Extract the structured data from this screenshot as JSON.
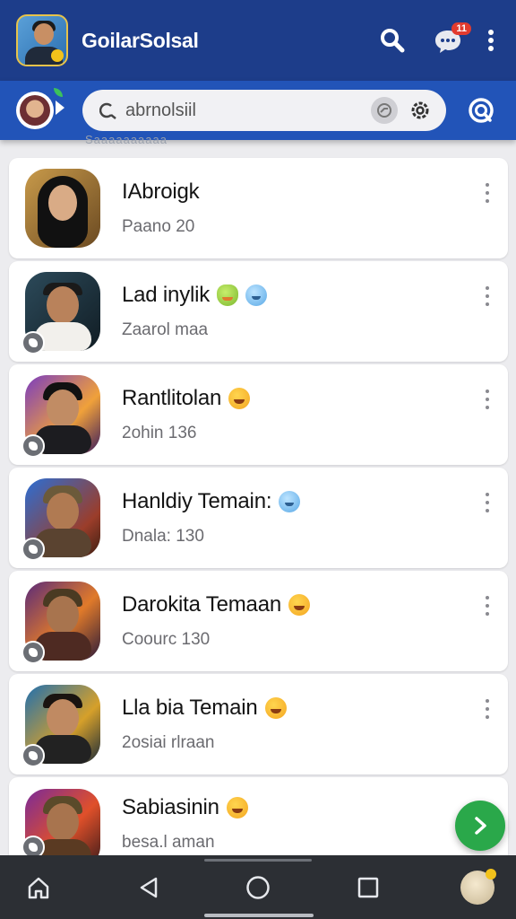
{
  "app": {
    "title": "GoilarSolsal",
    "notification_badge": "11"
  },
  "search": {
    "placeholder": "abrnolsiil",
    "value": ""
  },
  "scroll_hint": "Saaaaaaaaaa",
  "contacts": [
    {
      "name": "IAbroigk",
      "subtitle": "Paano 20",
      "emoji": "",
      "avatar": "woman-hijab",
      "has_badge": false
    },
    {
      "name": "Lad inylik",
      "subtitle": "Zaarol maa",
      "emoji": "frog+blue",
      "avatar": "man-smile",
      "has_badge": true
    },
    {
      "name": "Rantlitolan",
      "subtitle": "2ohin 136",
      "emoji": "grin",
      "avatar": "man-beanie",
      "has_badge": true
    },
    {
      "name": "Hanldiy Temain:",
      "subtitle": "Dnala: 130",
      "emoji": "blue",
      "avatar": "soldier",
      "has_badge": true
    },
    {
      "name": "Darokita Temaan",
      "subtitle": "Coourc 130",
      "emoji": "grin",
      "avatar": "warrior",
      "has_badge": true
    },
    {
      "name": "Lla bia Temain",
      "subtitle": "2osiai rlraan",
      "emoji": "grin",
      "avatar": "man-jacket",
      "has_badge": true
    },
    {
      "name": "Sabiasinin",
      "subtitle": "besa.l aman",
      "emoji": "grin",
      "avatar": "soldier-2",
      "has_badge": true
    }
  ],
  "colors": {
    "appbar": "#1d3d8a",
    "searchbar": "#2254b8",
    "fab": "#2aa84a",
    "navbar": "#2c2f34"
  },
  "icons": {
    "search": "search-icon",
    "chat": "chat-icon",
    "menu": "more-vert-icon",
    "gear": "gear-icon",
    "status": "status-icon",
    "fab": "chevron-right-icon",
    "home": "home-icon",
    "back": "back-icon",
    "circle": "home-circle-icon",
    "recents": "recents-icon"
  }
}
